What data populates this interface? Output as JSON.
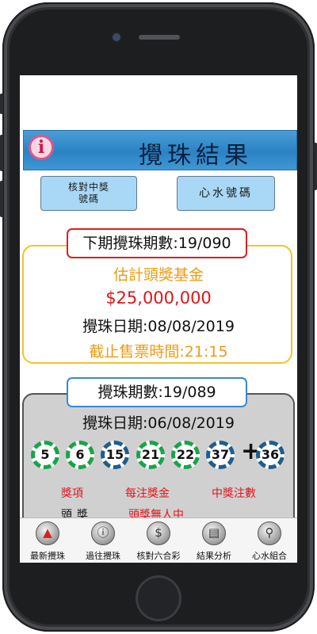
{
  "header": {
    "title": "攪珠結果",
    "info_glyph": "i"
  },
  "buttons": {
    "check_prize": "核對中獎\n號碼",
    "lucky_numbers": "心水號碼"
  },
  "next_draw": {
    "draw_no_label": "下期攪珠期數:19/090",
    "jackpot_label": "估計頭獎基金",
    "jackpot_amount": "$25,000,000",
    "draw_date": "攪珠日期:08/08/2019",
    "deadline": "截止售票時間:21:15"
  },
  "last_draw": {
    "draw_no_label": "攪珠期數:19/089",
    "draw_date": "攪珠日期:06/08/2019",
    "balls": [
      {
        "number": "5",
        "color": "green"
      },
      {
        "number": "6",
        "color": "green"
      },
      {
        "number": "15",
        "color": "blue"
      },
      {
        "number": "21",
        "color": "green"
      },
      {
        "number": "22",
        "color": "green"
      },
      {
        "number": "37",
        "color": "blue"
      }
    ],
    "plus": "+",
    "extra_ball": {
      "number": "36",
      "color": "blue"
    },
    "prize_headers": [
      "獎項",
      "每注獎金",
      "中獎注數"
    ],
    "first_row": {
      "prize": "頭獎",
      "amount": "頭獎無人中"
    }
  },
  "tabs": [
    {
      "label": "最新攪珠",
      "icon": "home-icon"
    },
    {
      "label": "過往攪珠",
      "icon": "info-icon"
    },
    {
      "label": "核對六合彩",
      "icon": "dollar-icon"
    },
    {
      "label": "結果分析",
      "icon": "bar-chart-icon"
    },
    {
      "label": "心水組合",
      "icon": "magnifier-icon"
    }
  ],
  "colors": {
    "green_ball": "#18a44a",
    "blue_ball": "#1f5d8e",
    "accent_red": "#e2141b",
    "accent_orange": "#ee9b14"
  }
}
